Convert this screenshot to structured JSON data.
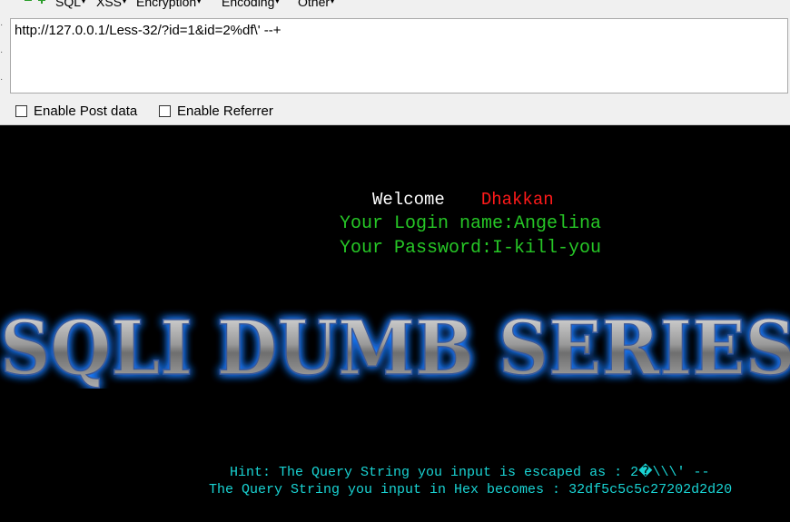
{
  "hackbar": {
    "menu": [
      {
        "label": "SQL"
      },
      {
        "label": "XSS"
      },
      {
        "label": "Encryption"
      },
      {
        "label": "Encoding"
      },
      {
        "label": "Other"
      }
    ],
    "url_value": "http://127.0.0.1/Less-32/?id=1&id=2%df\\' --+",
    "enable_post_label": "Enable Post data",
    "enable_referrer_label": "Enable Referrer",
    "enable_post_checked": false,
    "enable_referrer_checked": false
  },
  "page": {
    "welcome_label": "Welcome",
    "welcome_name": "Dhakkan",
    "login_line": "Your Login name:Angelina",
    "password_line": "Your Password:I-kill-you",
    "banner_text": "SQLI DUMB SERIES",
    "hint_line": "Hint: The Query String you input is escaped as : 2�\\\\\\' --",
    "hex_line": "The Query String you input in Hex becomes : 32df5c5c5c27202d2d20"
  },
  "colors": {
    "background": "#000000",
    "welcome": "#ffffff",
    "name": "#ff1a1a",
    "credentials": "#26c626",
    "hint": "#19d3d3",
    "banner_glow": "#1f7cff"
  }
}
